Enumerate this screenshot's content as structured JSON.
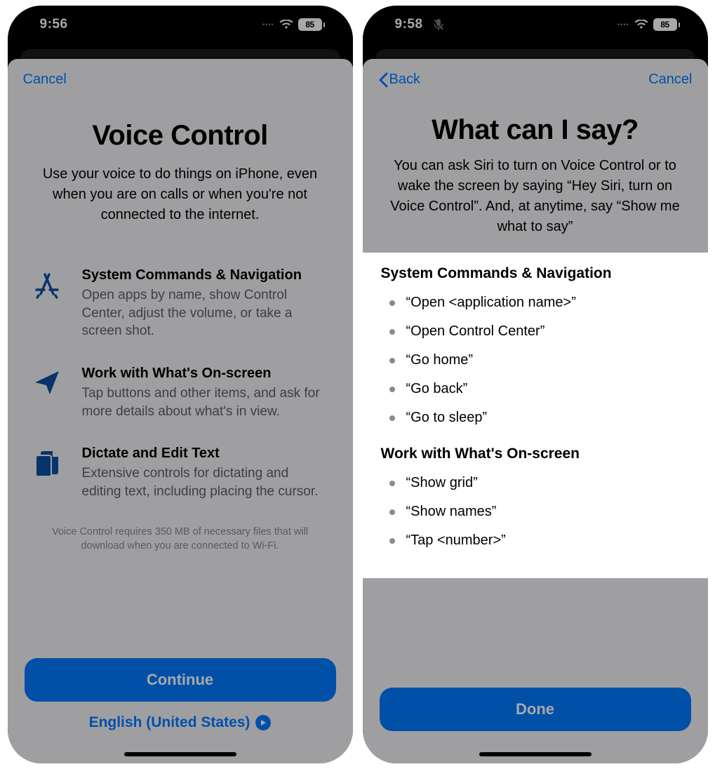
{
  "screen1": {
    "status": {
      "time": "9:56",
      "battery": "85"
    },
    "nav": {
      "cancel": "Cancel"
    },
    "title": "Voice Control",
    "subtitle": "Use your voice to do things on iPhone, even when you are on calls or when you're not connected to the internet.",
    "features": [
      {
        "title": "System Commands & Navigation",
        "desc": "Open apps by name, show Control Center, adjust the volume, or take a screen shot."
      },
      {
        "title": "Work with What's On-screen",
        "desc": "Tap buttons and other items, and ask for more details about what's in view."
      },
      {
        "title": "Dictate and Edit Text",
        "desc": "Extensive controls for dictating and editing text, including placing the cursor."
      }
    ],
    "footnote": "Voice Control requires 350 MB of necessary files that will download when you are connected to Wi-Fi.",
    "continue": "Continue",
    "language": "English (United States)"
  },
  "screen2": {
    "status": {
      "time": "9:58",
      "battery": "85"
    },
    "nav": {
      "back": "Back",
      "cancel": "Cancel"
    },
    "title": "What can I say?",
    "subtitle": "You can ask Siri to turn on Voice Control or to wake the screen by saying “Hey Siri, turn on Voice Control”. And, at anytime, say “Show me what to say”",
    "sections": [
      {
        "title": "System Commands & Navigation",
        "items": [
          "“Open <application name>”",
          "“Open Control Center”",
          "“Go home”",
          "“Go back”",
          "“Go to sleep”"
        ]
      },
      {
        "title": "Work with What's On-screen",
        "items": [
          "“Show grid”",
          "“Show names”",
          "“Tap <number>”"
        ]
      }
    ],
    "done": "Done"
  }
}
